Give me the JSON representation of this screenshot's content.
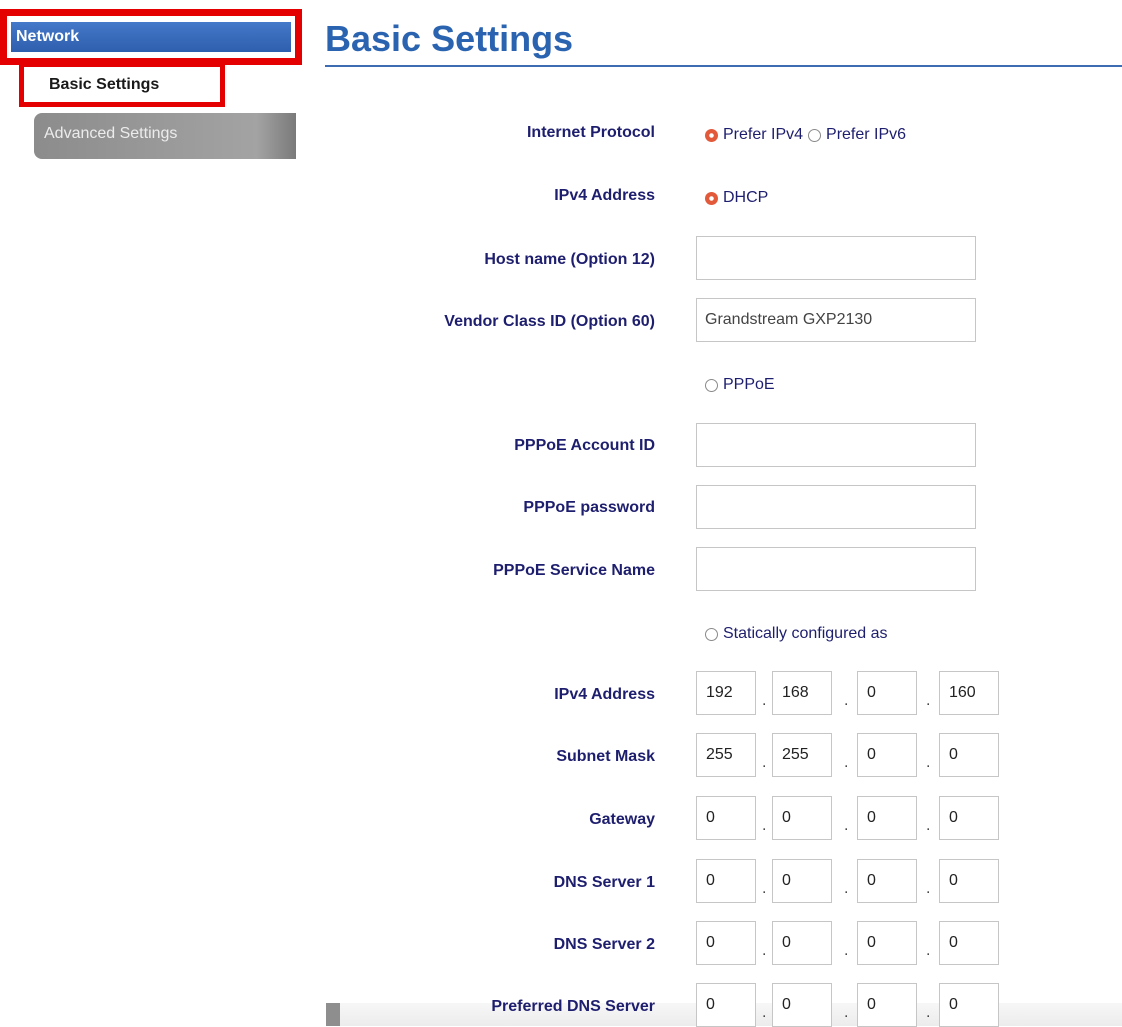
{
  "sidebar": {
    "network_label": "Network",
    "basic_label": "Basic Settings",
    "advanced_label": "Advanced Settings"
  },
  "header": {
    "title": "Basic Settings"
  },
  "form": {
    "internet_protocol": {
      "label": "Internet Protocol",
      "options": [
        "Prefer IPv4",
        "Prefer IPv6"
      ],
      "selected": "Prefer IPv4"
    },
    "ipv4_address_mode": {
      "label": "IPv4 Address",
      "options": [
        "DHCP",
        "PPPoE",
        "Statically configured as"
      ],
      "selected": "DHCP"
    },
    "dhcp": {
      "host_name_label": "Host name (Option 12)",
      "host_name_value": "",
      "vendor_class_label": "Vendor Class ID (Option 60)",
      "vendor_class_value": "Grandstream GXP2130"
    },
    "pppoe": {
      "account_label": "PPPoE Account ID",
      "account_value": "",
      "password_label": "PPPoE password",
      "password_value": "",
      "service_label": "PPPoE Service Name",
      "service_value": ""
    },
    "static": {
      "ipv4": {
        "label": "IPv4 Address",
        "octets": [
          "192",
          "168",
          "0",
          "160"
        ]
      },
      "subnet": {
        "label": "Subnet Mask",
        "octets": [
          "255",
          "255",
          "0",
          "0"
        ]
      },
      "gateway": {
        "label": "Gateway",
        "octets": [
          "0",
          "0",
          "0",
          "0"
        ]
      },
      "dns1": {
        "label": "DNS Server 1",
        "octets": [
          "0",
          "0",
          "0",
          "0"
        ]
      },
      "dns2": {
        "label": "DNS Server 2",
        "octets": [
          "0",
          "0",
          "0",
          "0"
        ]
      },
      "preferred_dns": {
        "label": "Preferred DNS Server",
        "octets": [
          "0",
          "0",
          "0",
          "0"
        ]
      }
    },
    "dot": "."
  },
  "colors": {
    "accent_blue": "#2a63b0",
    "highlight_red": "#e40000",
    "label_navy": "#1e1e6e",
    "radio_selected": "#e35a3a"
  }
}
